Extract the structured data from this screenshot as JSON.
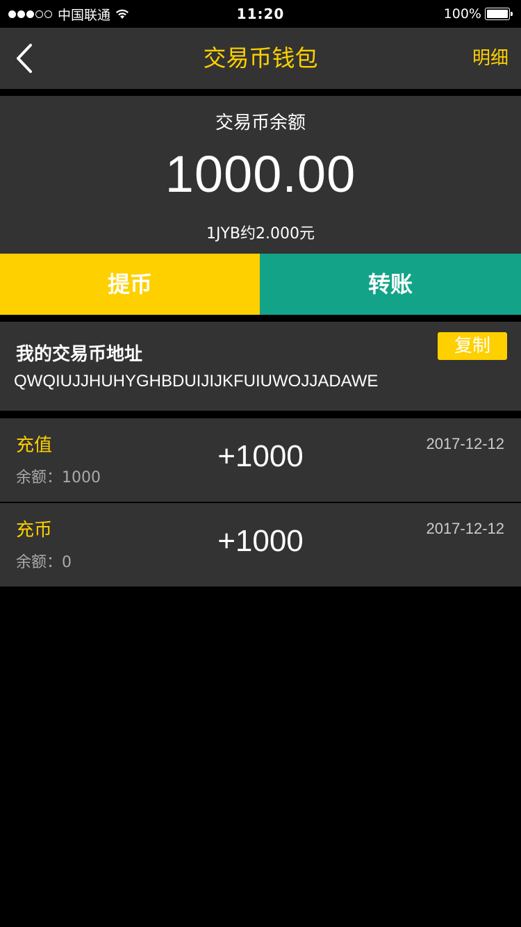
{
  "status_bar": {
    "carrier": "中国联通",
    "time": "11:20",
    "battery": "100%",
    "signal_filled": 3,
    "signal_empty": 2
  },
  "nav": {
    "title": "交易币钱包",
    "detail_label": "明细",
    "back_icon": "chevron-left-icon"
  },
  "balance": {
    "label": "交易币余额",
    "amount": "1000.00",
    "rate": "1JYB约2.000元"
  },
  "actions": {
    "withdraw_label": "提币",
    "transfer_label": "转账"
  },
  "address": {
    "title": "我的交易币地址",
    "copy_label": "复制",
    "value": "QWQIUJJHUHYGHBDUIJIJKFUIUWOJJADAWE"
  },
  "records": [
    {
      "type": "充值",
      "balance": "余额：1000",
      "amount": "+1000",
      "date": "2017-12-12"
    },
    {
      "type": "充币",
      "balance": "余额：0",
      "amount": "+1000",
      "date": "2017-12-12"
    }
  ],
  "colors": {
    "accent": "#fed000",
    "teal": "#12a389",
    "panel": "#333333",
    "background": "#000000"
  }
}
